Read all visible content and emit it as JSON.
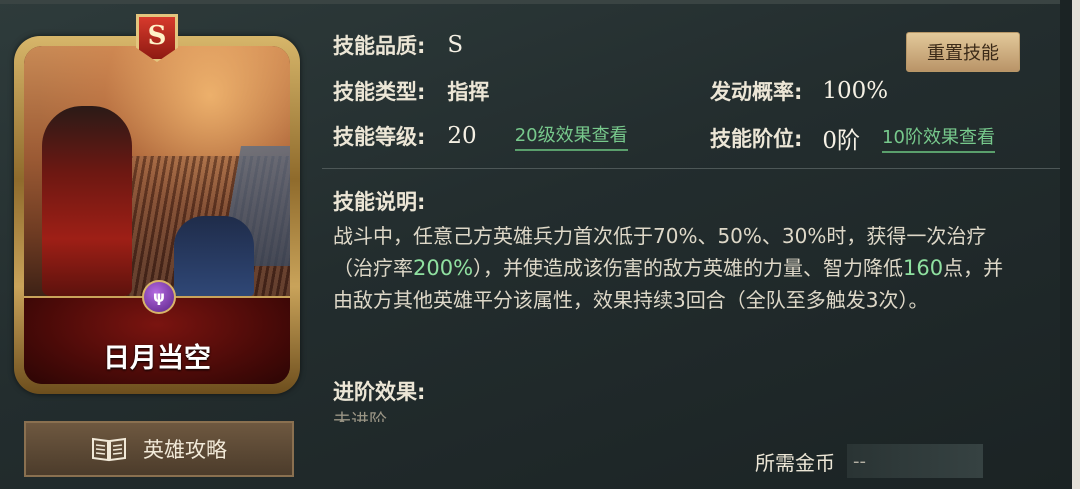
{
  "card": {
    "grade": "S",
    "skill_name": "日月当空",
    "type_icon_glyph": "ψ"
  },
  "guide_button": {
    "label": "英雄攻略"
  },
  "reset_button": {
    "label": "重置技能"
  },
  "info": {
    "quality_label": "技能品质:",
    "quality_value": "S",
    "type_label": "技能类型:",
    "type_value": "指挥",
    "trigger_label": "发动概率:",
    "trigger_value": "100%",
    "level_label": "技能等级:",
    "level_value": "20",
    "level_link": "20级效果查看",
    "rank_label": "技能阶位:",
    "rank_value": "0阶",
    "rank_link": "10阶效果查看"
  },
  "description": {
    "label": "技能说明:",
    "part1": "战斗中，任意己方英雄兵力首次低于70%、50%、30%时，获得一次治疗（治疗率",
    "highlight1": "200%",
    "part2": "），并使造成该伤害的敌方英雄的力量、智力降低",
    "highlight2": "160",
    "part3": "点，并由敌方其他英雄平分该属性，效果持续3回合（全队至多触发3次）。"
  },
  "advance": {
    "label": "进阶效果:",
    "value": "未进阶"
  },
  "gold": {
    "label": "所需金币",
    "value": "--"
  },
  "colors": {
    "highlight": "#8fe0a0",
    "link": "#77c98c",
    "reset_button_bg": "#d8bb8a"
  }
}
